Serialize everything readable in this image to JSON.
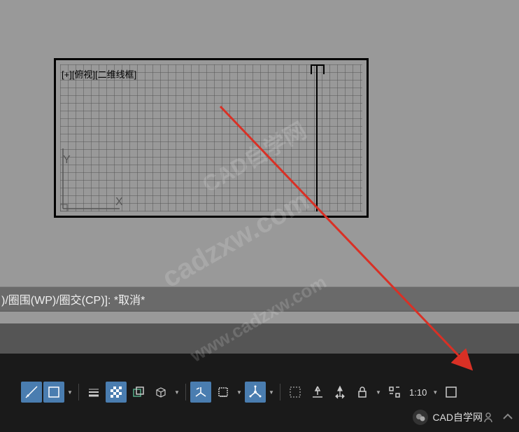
{
  "viewport": {
    "label": "[+][俯视][二维线框]",
    "ucs_x": "X",
    "ucs_y": "Y"
  },
  "command_line": ")/圈围(WP)/圈交(CP)]: *取消*",
  "status_bar": {
    "scale": "1:10",
    "icons": [
      "polar-tracking",
      "osnap",
      "grid-display",
      "snap-mode",
      "ortho",
      "isoplane",
      "object-snap",
      "3d-osnap",
      "dyn-input",
      "ucs",
      "selection-cycling",
      "filter",
      "gizmo",
      "lock",
      "quick-properties",
      "annotation-scale",
      "viewport-max"
    ]
  },
  "watermark": {
    "text1": "CAD自学网",
    "text2": "cadzxw.com",
    "text3": "www.cadzxw.com"
  },
  "overlay": {
    "wechat_label": "CAD自学网"
  },
  "colors": {
    "bg": "#999999",
    "accent": "#4a7db0",
    "dark": "#1a1a1a",
    "arrow": "#d93025"
  }
}
